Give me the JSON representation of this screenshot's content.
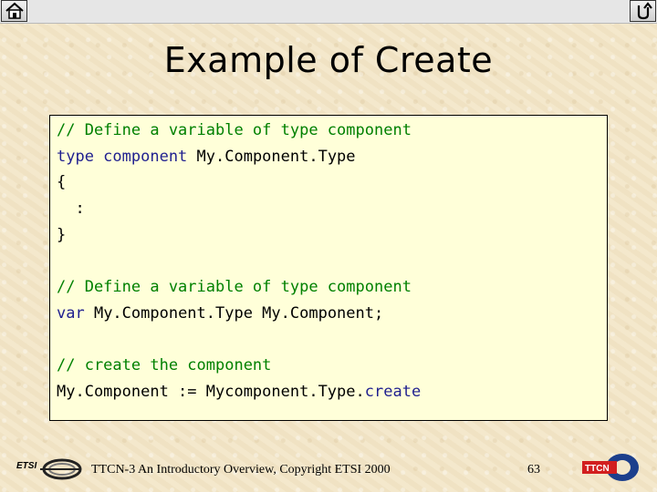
{
  "slide": {
    "title": "Example of Create",
    "code_lines": [
      [
        {
          "t": "// Define a variable of type component",
          "c": "c"
        }
      ],
      [
        {
          "t": "type component ",
          "c": "k"
        },
        {
          "t": "My.Component.Type",
          "c": "p"
        }
      ],
      [
        {
          "t": "{",
          "c": "p"
        }
      ],
      [
        {
          "t": "  :",
          "c": "p"
        }
      ],
      [
        {
          "t": "}",
          "c": "p"
        }
      ],
      [],
      [
        {
          "t": "// Define a variable of type component",
          "c": "c"
        }
      ],
      [
        {
          "t": "var ",
          "c": "k"
        },
        {
          "t": "My.Component.Type My.Component;",
          "c": "p"
        }
      ],
      [],
      [
        {
          "t": "// create the component",
          "c": "c"
        }
      ],
      [
        {
          "t": "My.Component := Mycomponent.Type.",
          "c": "p"
        },
        {
          "t": "create",
          "c": "k"
        }
      ]
    ]
  },
  "footer": {
    "text": "TTCN-3 An Introductory Overview, Copyright ETSI 2000",
    "page_number": "63",
    "etsi_logo_text": "ETSI",
    "ttcn_logo_text": "TTCN"
  },
  "nav": {
    "home_icon": "home-icon",
    "back_icon": "return-icon"
  },
  "colors": {
    "comment": "#008000",
    "keyword": "#1f1f8f",
    "code_background": "#ffffd9"
  }
}
